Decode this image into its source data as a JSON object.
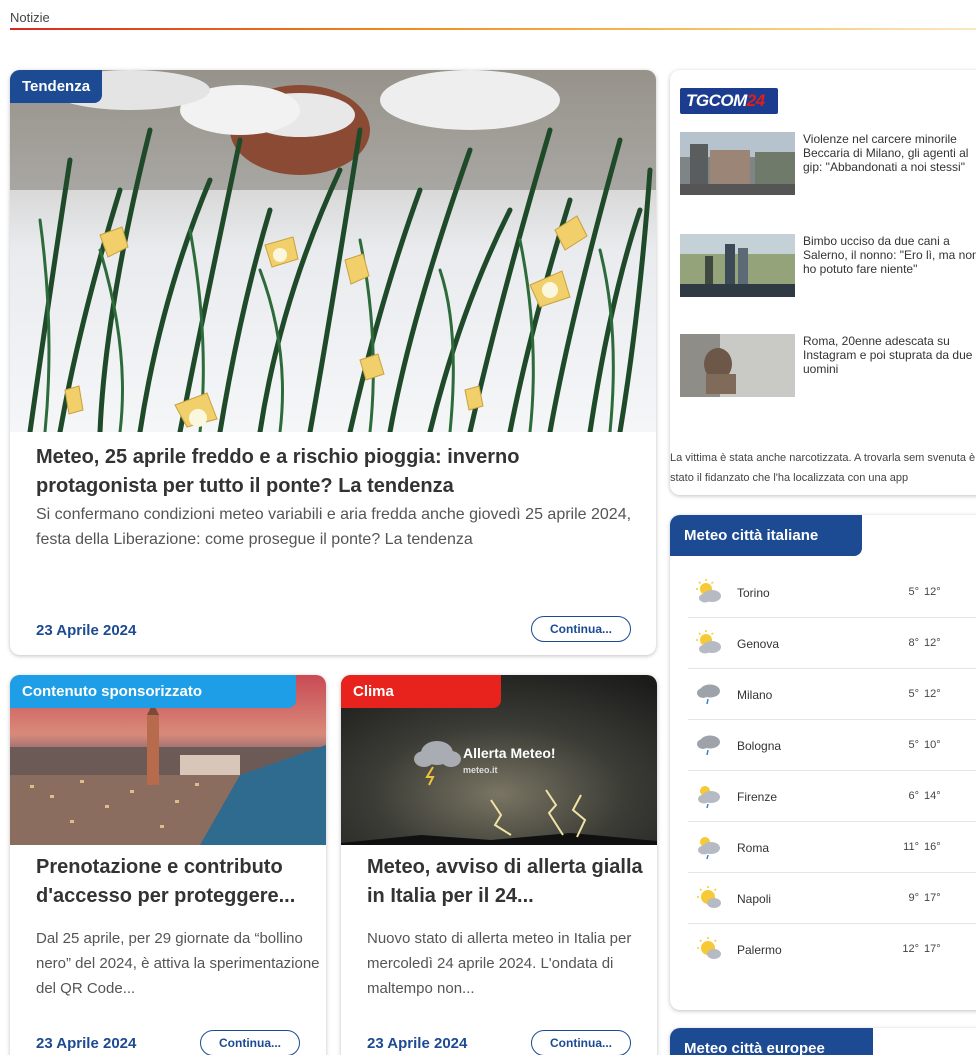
{
  "header": {
    "section": "Notizie"
  },
  "main_article": {
    "tag": "Tendenza",
    "tag_color": "#1c4a93",
    "title": "Meteo, 25 aprile freddo e a rischio pioggia: inverno protagonista per tutto il ponte? La tendenza",
    "description": "Si confermano condizioni meteo variabili e aria fredda anche giovedì 25 aprile 2024, festa della Liberazione: come prosegue il ponte? La tendenza",
    "date": "23 Aprile 2024",
    "button": "Continua..."
  },
  "sponsored_article": {
    "tag": "Contenuto sponsorizzato",
    "tag_color": "#1e9ee6",
    "title": "Prenotazione e contributo d'accesso per proteggere...",
    "description": "Dal 25 aprile, per 29 giornate da “bollino nero” del 2024, è attiva la sperimentazione del QR Code...",
    "date": "23 Aprile 2024",
    "button": "Continua..."
  },
  "clima_article": {
    "tag": "Clima",
    "tag_color": "#e8231d",
    "image_caption": "Allerta Meteo!",
    "image_brand": "meteo.it",
    "title": "Meteo, avviso di allerta gialla in Italia per il 24...",
    "description": "Nuovo stato di allerta meteo in Italia per mercoledì 24 aprile 2024. L'ondata di maltempo non...",
    "date": "23 Aprile 2024",
    "button": "Continua..."
  },
  "tgcom": {
    "logo_main": "TGCOM",
    "logo_num": "24",
    "items": [
      {
        "text": "Violenze nel carcere minorile Beccaria di Milano, gli agenti al gip: \"Abbandonati a noi stessi\""
      },
      {
        "text": "Bimbo ucciso da due cani a Salerno, il nonno: \"Ero lì, ma non ho potuto fare niente\""
      },
      {
        "text": "Roma, 20enne adescata su Instagram e poi stuprata da due uomini"
      }
    ],
    "sub_text": "La vittima è stata anche narcotizzata. A trovarla sem svenuta è stato il fidanzato che l'ha localizzata con una app"
  },
  "meteo_italiane": {
    "title": "Meteo città italiane",
    "cities": [
      {
        "name": "Torino",
        "min": "5°",
        "max": "12°",
        "icon": "sun-cloud-icon"
      },
      {
        "name": "Genova",
        "min": "8°",
        "max": "12°",
        "icon": "sun-cloud-icon"
      },
      {
        "name": "Milano",
        "min": "5°",
        "max": "12°",
        "icon": "rain-cloud-icon"
      },
      {
        "name": "Bologna",
        "min": "5°",
        "max": "10°",
        "icon": "rain-cloud-icon"
      },
      {
        "name": "Firenze",
        "min": "6°",
        "max": "14°",
        "icon": "sun-rain-icon"
      },
      {
        "name": "Roma",
        "min": "11°",
        "max": "16°",
        "icon": "sun-rain-icon"
      },
      {
        "name": "Napoli",
        "min": "9°",
        "max": "17°",
        "icon": "sun-cloud-icon"
      },
      {
        "name": "Palermo",
        "min": "12°",
        "max": "17°",
        "icon": "sun-cloud-icon"
      }
    ]
  },
  "meteo_europee": {
    "title": "Meteo città europee"
  }
}
